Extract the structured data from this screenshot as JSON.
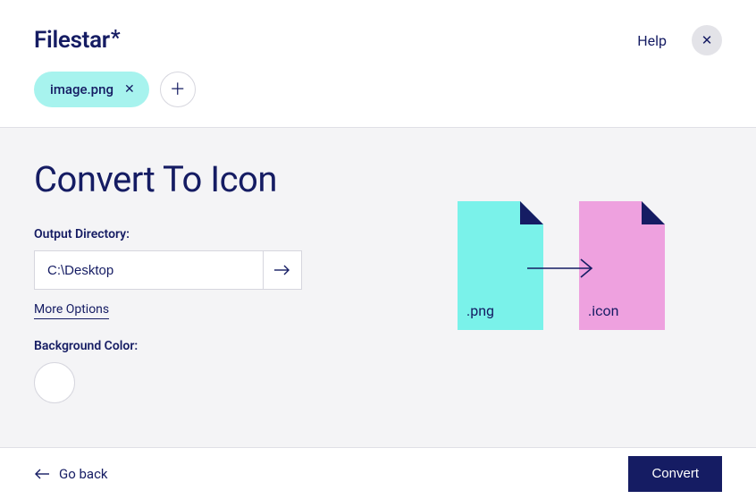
{
  "header": {
    "logo_text": "Filestar",
    "help_label": "Help"
  },
  "files": {
    "items": [
      {
        "name": "image.png"
      }
    ]
  },
  "page": {
    "title": "Convert To Icon"
  },
  "output": {
    "label": "Output Directory:",
    "value": "C:\\Desktop",
    "more_options_label": "More Options"
  },
  "background": {
    "label": "Background Color:",
    "selected_hex": "#ffffff"
  },
  "diagram": {
    "from_ext": ".png",
    "to_ext": ".icon",
    "from_color": "#7af2ea",
    "to_color": "#eea1df",
    "fold_color": "#151c63"
  },
  "footer": {
    "go_back_label": "Go back",
    "convert_label": "Convert"
  }
}
